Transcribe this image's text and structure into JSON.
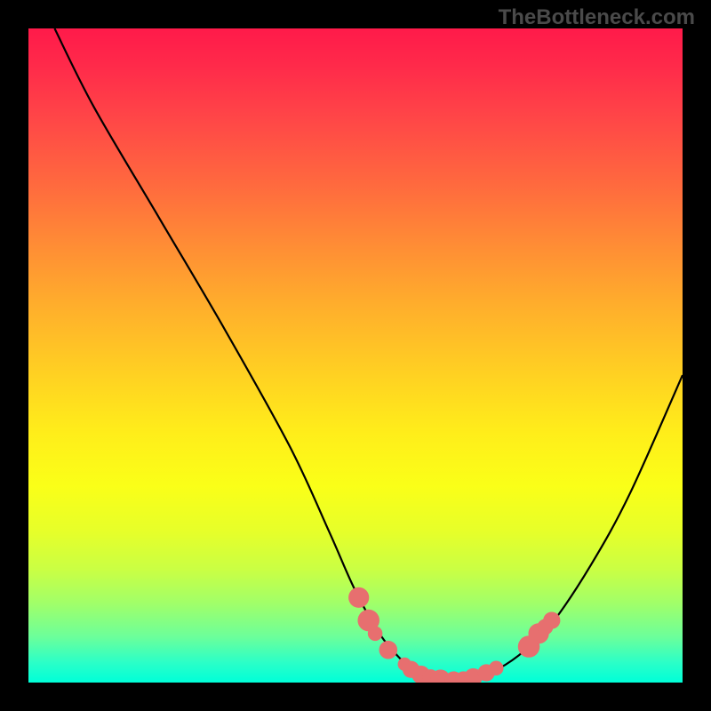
{
  "watermark": "TheBottleneck.com",
  "chart_data": {
    "type": "line",
    "title": "",
    "xlabel": "",
    "ylabel": "",
    "xlim": [
      0,
      100
    ],
    "ylim": [
      0,
      100
    ],
    "series": [
      {
        "name": "curve",
        "x": [
          4,
          10,
          20,
          30,
          40,
          46,
          50,
          54,
          58,
          60,
          62,
          64,
          66,
          68,
          72,
          76,
          80,
          86,
          92,
          100
        ],
        "y": [
          100,
          88,
          71,
          54,
          36,
          23,
          14,
          7,
          2.5,
          1.2,
          0.6,
          0.3,
          0.4,
          0.8,
          2.2,
          5,
          9,
          18,
          29,
          47
        ]
      }
    ],
    "markers": [
      {
        "x": 50.5,
        "y": 13.0,
        "r": 1.3
      },
      {
        "x": 52.0,
        "y": 9.5,
        "r": 1.4
      },
      {
        "x": 53.0,
        "y": 7.5,
        "r": 0.8
      },
      {
        "x": 55.0,
        "y": 5.0,
        "r": 1.1
      },
      {
        "x": 57.5,
        "y": 2.8,
        "r": 0.7
      },
      {
        "x": 58.5,
        "y": 2.0,
        "r": 1.0
      },
      {
        "x": 60.0,
        "y": 1.2,
        "r": 1.1
      },
      {
        "x": 61.5,
        "y": 0.8,
        "r": 0.9
      },
      {
        "x": 63.0,
        "y": 0.5,
        "r": 1.2
      },
      {
        "x": 65.0,
        "y": 0.4,
        "r": 1.0
      },
      {
        "x": 66.5,
        "y": 0.5,
        "r": 0.9
      },
      {
        "x": 68.0,
        "y": 0.8,
        "r": 1.1
      },
      {
        "x": 70.0,
        "y": 1.5,
        "r": 1.0
      },
      {
        "x": 71.5,
        "y": 2.2,
        "r": 0.8
      },
      {
        "x": 76.5,
        "y": 5.5,
        "r": 1.4
      },
      {
        "x": 78.0,
        "y": 7.5,
        "r": 1.3
      },
      {
        "x": 79.0,
        "y": 8.5,
        "r": 0.9
      },
      {
        "x": 80.0,
        "y": 9.5,
        "r": 1.0
      }
    ],
    "colors": {
      "curve_stroke": "#000000",
      "marker_fill": "#e76f6f",
      "gradient_top": "#ff1a4a",
      "gradient_bottom": "#00ffd8"
    }
  }
}
